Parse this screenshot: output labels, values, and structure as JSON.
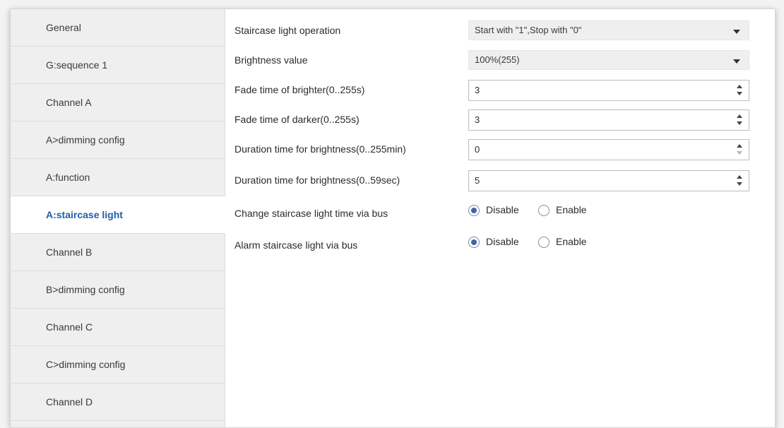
{
  "sidebar": {
    "items": [
      {
        "label": "General"
      },
      {
        "label": "G:sequence 1"
      },
      {
        "label": "Channel A"
      },
      {
        "label": "A>dimming config"
      },
      {
        "label": "A:function"
      },
      {
        "label": "A:staircase light"
      },
      {
        "label": "Channel B"
      },
      {
        "label": "B>dimming config"
      },
      {
        "label": "Channel C"
      },
      {
        "label": "C>dimming config"
      },
      {
        "label": "Channel D"
      }
    ],
    "selected": "A:staircase light"
  },
  "settings": {
    "staircase_light_operation": {
      "label": "Staircase light operation",
      "value": "Start with \"1\",Stop with \"0\""
    },
    "brightness_value": {
      "label": "Brightness value",
      "value": "100%(255)"
    },
    "fade_brighter": {
      "label": "Fade time of brighter(0..255s)",
      "value": "3"
    },
    "fade_darker": {
      "label": "Fade time of darker(0..255s)",
      "value": "3"
    },
    "duration_min": {
      "label": "Duration time for brightness(0..255min)",
      "value": "0"
    },
    "duration_sec": {
      "label": "Duration time for brightness(0..59sec)",
      "value": "5"
    },
    "change_time_via_bus": {
      "label": "Change staircase light time via bus",
      "options": [
        "Disable",
        "Enable"
      ],
      "selected": "Disable"
    },
    "alarm_via_bus": {
      "label": "Alarm staircase light via bus",
      "options": [
        "Disable",
        "Enable"
      ],
      "selected": "Disable"
    }
  },
  "colors": {
    "active_text": "#1f5fa8",
    "sidebar_bg": "#efefef",
    "radio_dot": "#3f67a3"
  }
}
